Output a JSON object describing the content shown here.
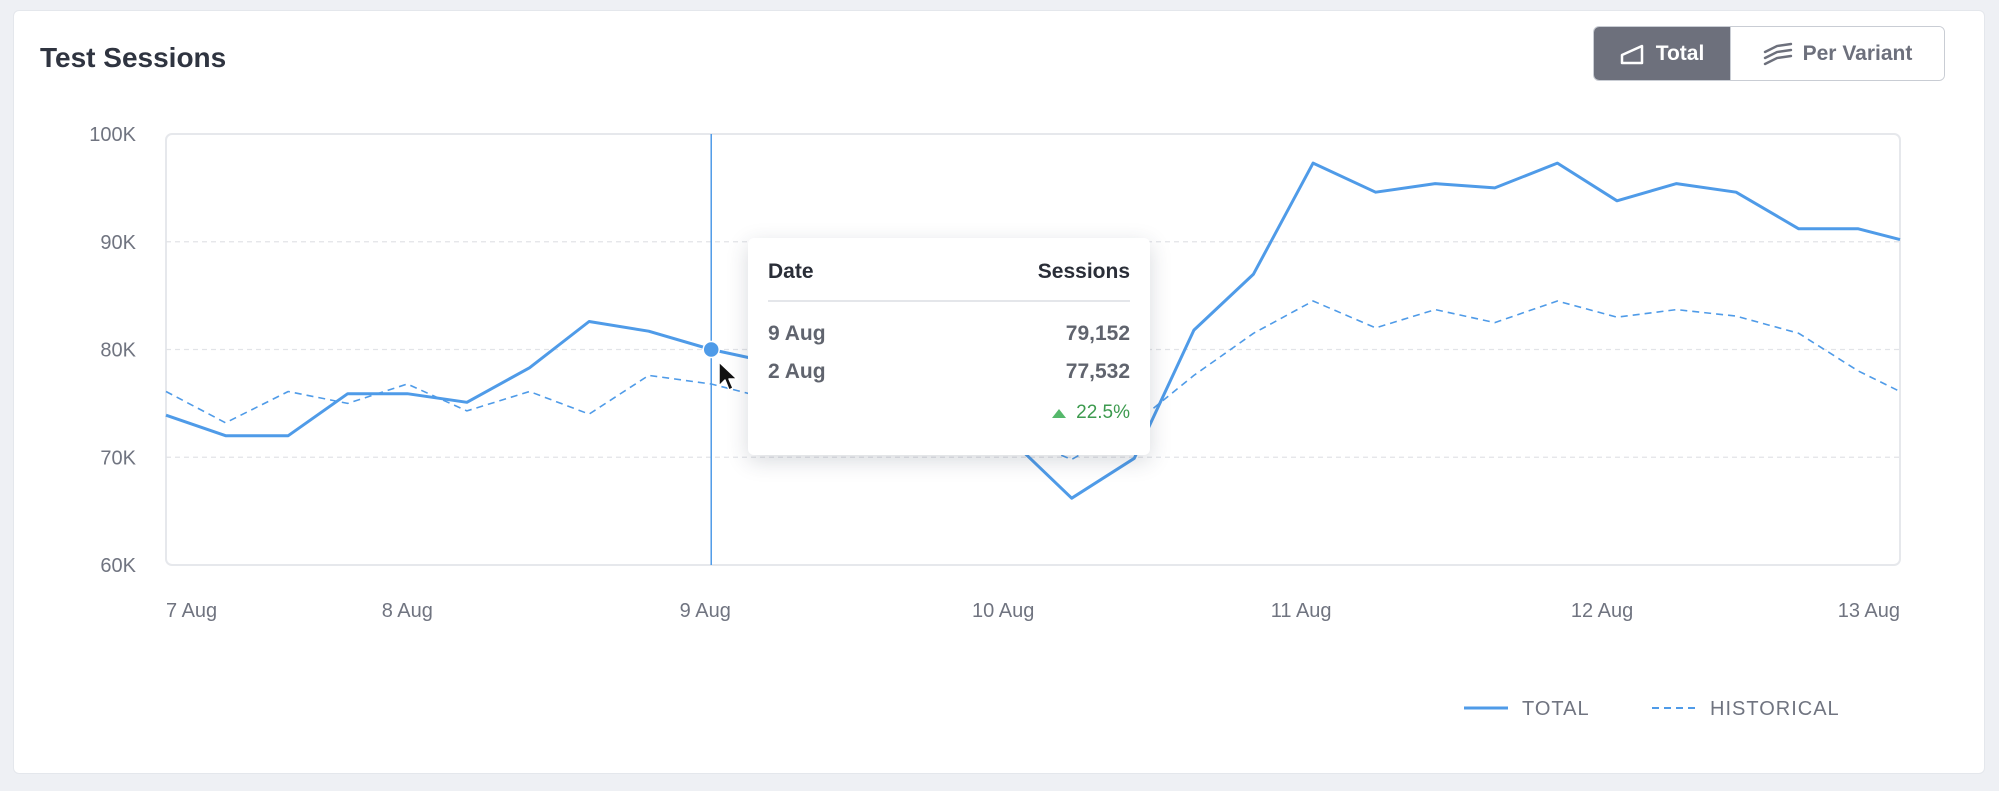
{
  "title": "Test Sessions",
  "toggle": {
    "total_label": "Total",
    "variant_label": "Per Variant",
    "active": "Total"
  },
  "colors": {
    "series": "#4f9be8",
    "active_toggle": "#6d707c",
    "up": "#55b86b"
  },
  "tooltip": {
    "col_date": "Date",
    "col_sessions": "Sessions",
    "rows": [
      {
        "date": "9 Aug",
        "sessions": "79,152"
      },
      {
        "date": "2 Aug",
        "sessions": "77,532"
      }
    ],
    "change": "22.5%",
    "hover_x": 1.83,
    "hover_y": 80000
  },
  "chart_data": {
    "type": "line",
    "y_ticks": [
      "100K",
      "90K",
      "80K",
      "70K",
      "60K"
    ],
    "y_tick_values": [
      100000,
      90000,
      80000,
      70000,
      60000
    ],
    "ylim": [
      60000,
      100000
    ],
    "xlim": [
      0,
      5.82
    ],
    "x_ticks": [
      {
        "label": "7 Aug",
        "value": 0
      },
      {
        "label": "8 Aug",
        "value": 0.81
      },
      {
        "label": "9 Aug",
        "value": 1.81
      },
      {
        "label": "10 Aug",
        "value": 2.81
      },
      {
        "label": "11 Aug",
        "value": 3.81
      },
      {
        "label": "12 Aug",
        "value": 4.82
      },
      {
        "label": "13 Aug",
        "value": 5.82
      }
    ],
    "grid": true,
    "legend": "bottom-right",
    "series": [
      {
        "name": "TOTAL",
        "style": "solid",
        "points": [
          [
            0.0,
            73900
          ],
          [
            0.2,
            72000
          ],
          [
            0.41,
            72000
          ],
          [
            0.61,
            75900
          ],
          [
            0.81,
            75900
          ],
          [
            1.01,
            75100
          ],
          [
            1.22,
            78300
          ],
          [
            1.42,
            82600
          ],
          [
            1.62,
            81700
          ],
          [
            1.83,
            80000
          ],
          [
            2.03,
            78800
          ],
          [
            2.23,
            77300
          ],
          [
            2.44,
            74800
          ],
          [
            2.64,
            72800
          ],
          [
            2.84,
            71500
          ],
          [
            3.04,
            66200
          ],
          [
            3.25,
            69900
          ],
          [
            3.45,
            81800
          ],
          [
            3.65,
            87000
          ],
          [
            3.85,
            97300
          ],
          [
            4.06,
            94600
          ],
          [
            4.26,
            95400
          ],
          [
            4.46,
            95000
          ],
          [
            4.67,
            97300
          ],
          [
            4.87,
            93800
          ],
          [
            5.07,
            95400
          ],
          [
            5.27,
            94600
          ],
          [
            5.48,
            91200
          ],
          [
            5.68,
            91200
          ],
          [
            5.82,
            90200
          ]
        ]
      },
      {
        "name": "HISTORICAL",
        "style": "dashed",
        "points": [
          [
            0.0,
            76100
          ],
          [
            0.2,
            73200
          ],
          [
            0.41,
            76100
          ],
          [
            0.61,
            75000
          ],
          [
            0.81,
            76800
          ],
          [
            1.01,
            74300
          ],
          [
            1.22,
            76100
          ],
          [
            1.42,
            74000
          ],
          [
            1.62,
            77600
          ],
          [
            1.83,
            76800
          ],
          [
            2.03,
            75400
          ],
          [
            2.23,
            74800
          ],
          [
            2.44,
            73800
          ],
          [
            2.64,
            72800
          ],
          [
            2.84,
            72000
          ],
          [
            3.04,
            69800
          ],
          [
            3.25,
            73100
          ],
          [
            3.45,
            77600
          ],
          [
            3.65,
            81500
          ],
          [
            3.85,
            84500
          ],
          [
            4.06,
            82000
          ],
          [
            4.26,
            83700
          ],
          [
            4.46,
            82500
          ],
          [
            4.67,
            84500
          ],
          [
            4.87,
            83000
          ],
          [
            5.07,
            83700
          ],
          [
            5.27,
            83100
          ],
          [
            5.48,
            81500
          ],
          [
            5.68,
            78000
          ],
          [
            5.82,
            76100
          ]
        ]
      }
    ]
  }
}
